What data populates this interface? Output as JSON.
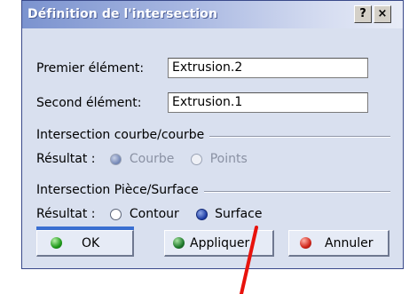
{
  "dialog": {
    "title": "Définition de l'intersection",
    "help_label": "?",
    "close_label": "×"
  },
  "fields": {
    "first_label": "Premier élément:",
    "first_value": "Extrusion.2",
    "second_label": "Second élément:",
    "second_value": "Extrusion.1"
  },
  "curve_section": {
    "title": "Intersection courbe/courbe",
    "result_label": "Résultat :",
    "options": [
      "Courbe",
      "Points"
    ],
    "selected": "Courbe",
    "enabled": false
  },
  "part_section": {
    "title": "Intersection Pièce/Surface",
    "result_label": "Résultat :",
    "options": [
      "Contour",
      "Surface"
    ],
    "selected": "Surface",
    "enabled": true
  },
  "buttons": {
    "ok": "OK",
    "apply": "Appliquer",
    "cancel": "Annuler"
  },
  "colors": {
    "annotation_stroke": "#e8120c",
    "dialog_background": "#d9e0ef",
    "title_gradient_start": "#7b93cf"
  }
}
